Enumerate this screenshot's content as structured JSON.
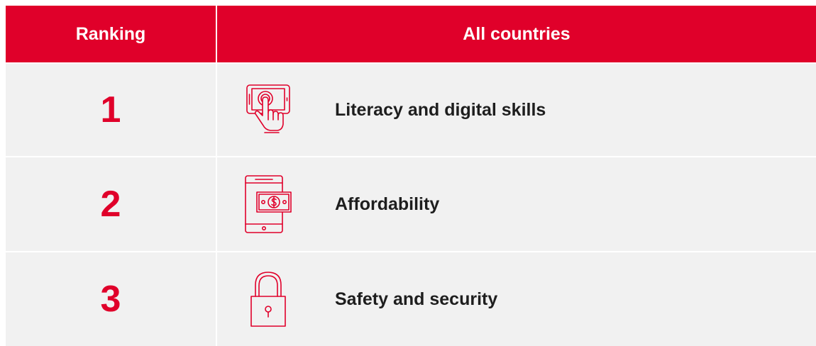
{
  "header": {
    "ranking_label": "Ranking",
    "countries_label": "All countries"
  },
  "rows": [
    {
      "rank": "1",
      "label": "Literacy and digital skills",
      "icon": "touchscreen-hand-icon"
    },
    {
      "rank": "2",
      "label": "Affordability",
      "icon": "phone-money-icon"
    },
    {
      "rank": "3",
      "label": "Safety and security",
      "icon": "padlock-icon"
    }
  ],
  "colors": {
    "accent": "#e0002a",
    "row_background": "#f1f1f1",
    "text": "#1e1e1e",
    "header_text": "#ffffff"
  }
}
